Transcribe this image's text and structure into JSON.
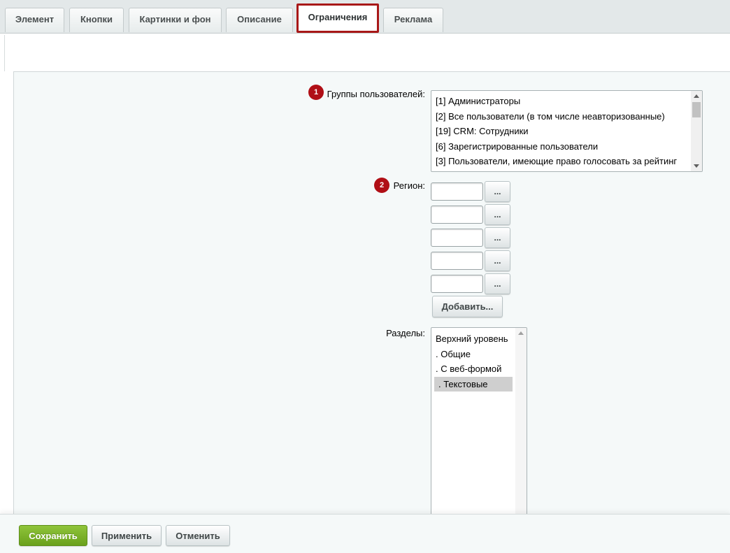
{
  "tabs": [
    {
      "label": "Элемент",
      "active": false
    },
    {
      "label": "Кнопки",
      "active": false
    },
    {
      "label": "Картинки и фон",
      "active": false
    },
    {
      "label": "Описание",
      "active": false
    },
    {
      "label": "Ограничения",
      "active": true
    },
    {
      "label": "Реклама",
      "active": false
    }
  ],
  "form": {
    "groups": {
      "marker": "1",
      "label": "Группы пользователей:",
      "options": [
        "[1] Администраторы",
        "[2] Все пользователи (в том числе неавторизованные)",
        "[19] CRM: Сотрудники",
        "[6] Зарегистрированные пользователи",
        "[3] Пользователи, имеющие право голосовать за рейтинг"
      ]
    },
    "region": {
      "marker": "2",
      "label": "Регион:",
      "inputs": [
        "",
        "",
        "",
        "",
        ""
      ],
      "browse_label": "...",
      "add_label": "Добавить..."
    },
    "sections": {
      "label": "Разделы:",
      "options": [
        {
          "text": "Верхний уровень",
          "selected": false
        },
        {
          "text": ". Общие",
          "selected": false
        },
        {
          "text": ". С веб-формой",
          "selected": false
        },
        {
          "text": ". Текстовые",
          "selected": true
        }
      ]
    }
  },
  "footer": {
    "save_label": "Сохранить",
    "apply_label": "Применить",
    "cancel_label": "Отменить"
  },
  "colors": {
    "accent_red": "#b00f16",
    "active_tab_border": "#a81818",
    "save_green": "#7bb32a"
  }
}
